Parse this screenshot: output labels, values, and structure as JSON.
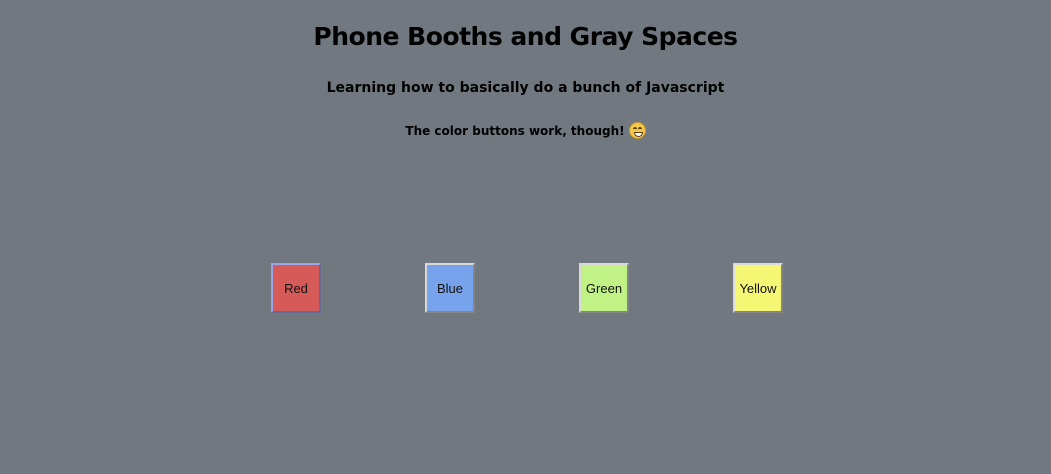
{
  "page": {
    "title": "Phone Booths and Gray Spaces",
    "subtitle": "Learning how to basically do a bunch of Javascript",
    "note": "The color buttons work, though!",
    "note_icon": "grinning-face-emoji",
    "background_color": "#717880"
  },
  "buttons": [
    {
      "label": "Red",
      "color": "#d65a58"
    },
    {
      "label": "Blue",
      "color": "#77a2ec"
    },
    {
      "label": "Green",
      "color": "#c0f285"
    },
    {
      "label": "Yellow",
      "color": "#f6f675"
    }
  ]
}
